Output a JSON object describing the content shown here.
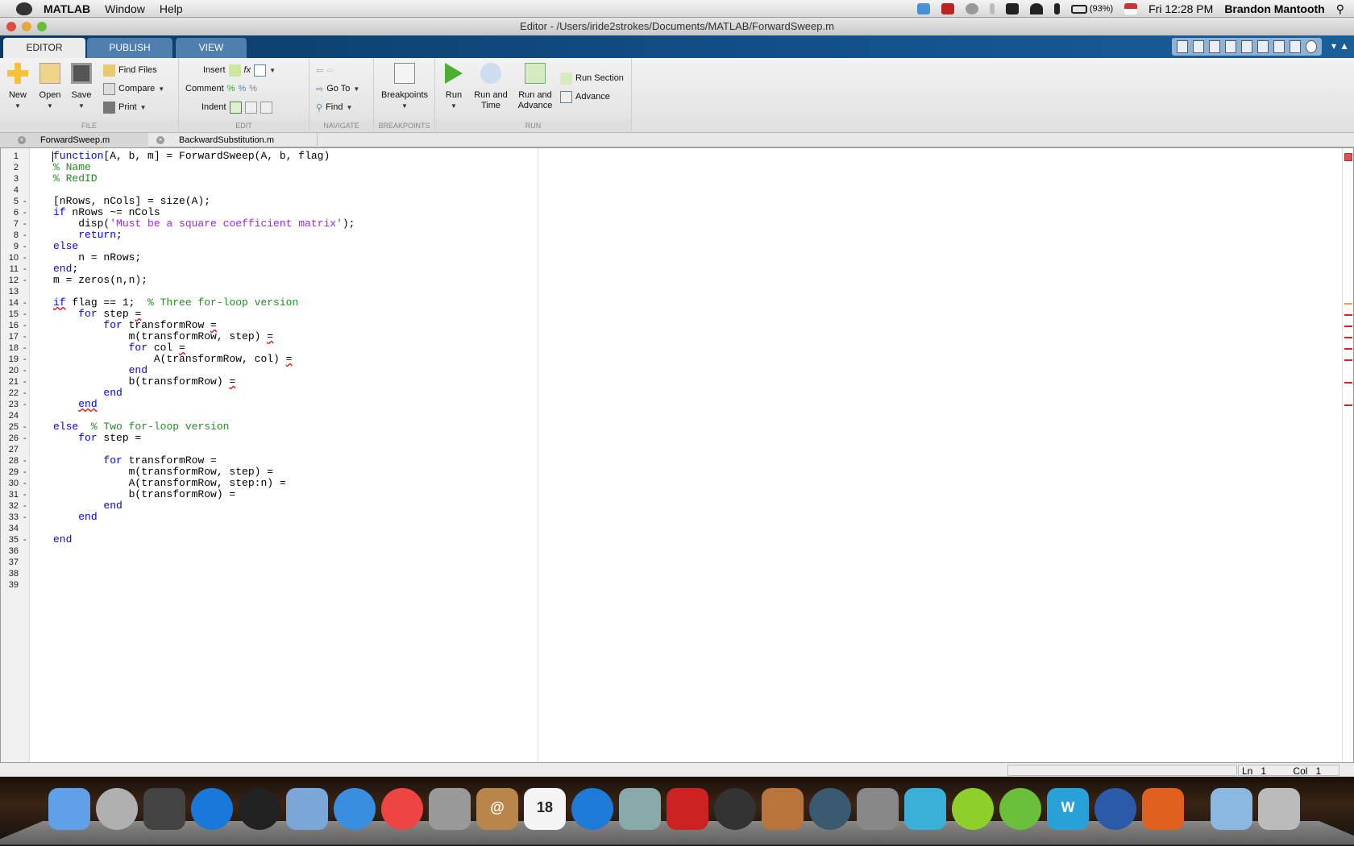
{
  "menubar": {
    "app": "MATLAB",
    "items": [
      "Window",
      "Help"
    ],
    "battery": "(93%)",
    "clock": "Fri 12:28 PM",
    "user": "Brandon Mantooth"
  },
  "window": {
    "title": "Editor - /Users/iride2strokes/Documents/MATLAB/ForwardSweep.m"
  },
  "ribbon": {
    "tabs": [
      "EDITOR",
      "PUBLISH",
      "VIEW"
    ],
    "file": {
      "label": "FILE",
      "new": "New",
      "open": "Open",
      "save": "Save",
      "find_files": "Find Files",
      "compare": "Compare",
      "print": "Print"
    },
    "edit": {
      "label": "EDIT",
      "insert": "Insert",
      "comment": "Comment",
      "indent": "Indent",
      "fx": "fx"
    },
    "navigate": {
      "label": "NAVIGATE",
      "goto": "Go To",
      "find": "Find"
    },
    "breakpoints": {
      "label": "BREAKPOINTS",
      "button": "Breakpoints"
    },
    "run": {
      "label": "RUN",
      "run": "Run",
      "run_and_time": "Run and Time",
      "run_and_advance": "Run and Advance",
      "run_section": "Run Section",
      "advance": "Advance"
    }
  },
  "file_tabs": [
    {
      "name": "ForwardSweep.m",
      "active": true
    },
    {
      "name": "BackwardSubstitution.m",
      "active": false
    }
  ],
  "editor": {
    "lines": [
      {
        "n": "1",
        "d": "",
        "segs": [
          [
            "kw",
            "function"
          ],
          [
            "",
            "[A, b, m] = ForwardSweep(A, b, flag)"
          ]
        ]
      },
      {
        "n": "2",
        "d": "",
        "segs": [
          [
            "cm",
            "% Name"
          ]
        ]
      },
      {
        "n": "3",
        "d": "",
        "segs": [
          [
            "cm",
            "% RedID"
          ]
        ]
      },
      {
        "n": "4",
        "d": "",
        "segs": []
      },
      {
        "n": "5",
        "d": "-",
        "segs": [
          [
            "",
            "[nRows, nCols] = size(A);"
          ]
        ]
      },
      {
        "n": "6",
        "d": "-",
        "segs": [
          [
            "kw",
            "if"
          ],
          [
            "",
            " nRows ~= nCols"
          ]
        ]
      },
      {
        "n": "7",
        "d": "-",
        "segs": [
          [
            "",
            "    disp("
          ],
          [
            "str",
            "'Must be a square coefficient matrix'"
          ],
          [
            "",
            ");"
          ]
        ]
      },
      {
        "n": "8",
        "d": "-",
        "segs": [
          [
            "",
            "    "
          ],
          [
            "kw",
            "return"
          ],
          [
            "",
            ";"
          ]
        ]
      },
      {
        "n": "9",
        "d": "-",
        "segs": [
          [
            "kw",
            "else"
          ]
        ]
      },
      {
        "n": "10",
        "d": "-",
        "segs": [
          [
            "",
            "    n = nRows;"
          ]
        ]
      },
      {
        "n": "11",
        "d": "-",
        "segs": [
          [
            "kw",
            "end"
          ],
          [
            "",
            ";"
          ]
        ]
      },
      {
        "n": "12",
        "d": "-",
        "segs": [
          [
            "",
            "m = zeros(n,n);"
          ]
        ]
      },
      {
        "n": "13",
        "d": "",
        "segs": []
      },
      {
        "n": "14",
        "d": "-",
        "segs": [
          [
            "kw warn",
            "if"
          ],
          [
            "",
            " flag == 1;  "
          ],
          [
            "cm",
            "% Three for-loop version"
          ]
        ]
      },
      {
        "n": "15",
        "d": "-",
        "segs": [
          [
            "",
            "    "
          ],
          [
            "kw",
            "for"
          ],
          [
            "",
            " step "
          ],
          [
            "warn",
            "="
          ]
        ]
      },
      {
        "n": "16",
        "d": "-",
        "segs": [
          [
            "",
            "        "
          ],
          [
            "kw",
            "for"
          ],
          [
            "",
            " transformRow "
          ],
          [
            "warn",
            "="
          ]
        ]
      },
      {
        "n": "17",
        "d": "-",
        "segs": [
          [
            "",
            "            m(transformRow, step) "
          ],
          [
            "warn",
            "="
          ]
        ]
      },
      {
        "n": "18",
        "d": "-",
        "segs": [
          [
            "",
            "            "
          ],
          [
            "kw",
            "for"
          ],
          [
            "",
            " col "
          ],
          [
            "warn",
            "="
          ]
        ]
      },
      {
        "n": "19",
        "d": "-",
        "segs": [
          [
            "",
            "                A(transformRow, col) "
          ],
          [
            "warn",
            "="
          ]
        ]
      },
      {
        "n": "20",
        "d": "-",
        "segs": [
          [
            "",
            "            "
          ],
          [
            "kw",
            "end"
          ]
        ]
      },
      {
        "n": "21",
        "d": "-",
        "segs": [
          [
            "",
            "            b(transformRow) "
          ],
          [
            "warn",
            "="
          ]
        ]
      },
      {
        "n": "22",
        "d": "-",
        "segs": [
          [
            "",
            "        "
          ],
          [
            "kw",
            "end"
          ]
        ]
      },
      {
        "n": "23",
        "d": "-",
        "segs": [
          [
            "",
            "    "
          ],
          [
            "kw warn",
            "end"
          ]
        ]
      },
      {
        "n": "24",
        "d": "",
        "segs": []
      },
      {
        "n": "25",
        "d": "-",
        "segs": [
          [
            "kw",
            "else"
          ],
          [
            "",
            "  "
          ],
          [
            "cm",
            "% Two for-loop version"
          ]
        ]
      },
      {
        "n": "26",
        "d": "-",
        "segs": [
          [
            "",
            "    "
          ],
          [
            "kw",
            "for"
          ],
          [
            "",
            " step ="
          ]
        ]
      },
      {
        "n": "27",
        "d": "",
        "segs": []
      },
      {
        "n": "28",
        "d": "-",
        "segs": [
          [
            "",
            "        "
          ],
          [
            "kw",
            "for"
          ],
          [
            "",
            " transformRow ="
          ]
        ]
      },
      {
        "n": "29",
        "d": "-",
        "segs": [
          [
            "",
            "            m(transformRow, step) ="
          ]
        ]
      },
      {
        "n": "30",
        "d": "-",
        "segs": [
          [
            "",
            "            A(transformRow, step:n) ="
          ]
        ]
      },
      {
        "n": "31",
        "d": "-",
        "segs": [
          [
            "",
            "            b(transformRow) ="
          ]
        ]
      },
      {
        "n": "32",
        "d": "-",
        "segs": [
          [
            "",
            "        "
          ],
          [
            "kw",
            "end"
          ]
        ]
      },
      {
        "n": "33",
        "d": "-",
        "segs": [
          [
            "",
            "    "
          ],
          [
            "kw",
            "end"
          ]
        ]
      },
      {
        "n": "34",
        "d": "",
        "segs": []
      },
      {
        "n": "35",
        "d": "-",
        "segs": [
          [
            "kw",
            "end"
          ]
        ]
      },
      {
        "n": "36",
        "d": "",
        "segs": []
      },
      {
        "n": "37",
        "d": "",
        "segs": []
      },
      {
        "n": "38",
        "d": "",
        "segs": []
      },
      {
        "n": "39",
        "d": "",
        "segs": []
      }
    ],
    "markers": [
      {
        "line": 14,
        "color": "#f0a030"
      },
      {
        "line": 15,
        "color": "#e02020"
      },
      {
        "line": 16,
        "color": "#e02020"
      },
      {
        "line": 17,
        "color": "#e02020"
      },
      {
        "line": 18,
        "color": "#e02020"
      },
      {
        "line": 19,
        "color": "#e02020"
      },
      {
        "line": 21,
        "color": "#e02020"
      },
      {
        "line": 23,
        "color": "#e02020"
      }
    ]
  },
  "status": {
    "ln_label": "Ln",
    "ln": "1",
    "col_label": "Col",
    "col": "1"
  },
  "dock": {
    "apps": [
      {
        "name": "Finder",
        "color": "#5fa0e8",
        "round": false
      },
      {
        "name": "Launchpad",
        "color": "#b0b0b0",
        "round": true
      },
      {
        "name": "Mission Control",
        "color": "#444",
        "round": false
      },
      {
        "name": "App Store",
        "color": "#1a78d8",
        "round": true
      },
      {
        "name": "Dashboard",
        "color": "#222",
        "round": true
      },
      {
        "name": "Mail",
        "color": "#7aa6d8",
        "round": false
      },
      {
        "name": "Safari",
        "color": "#3a8ee0",
        "round": true
      },
      {
        "name": "Chrome",
        "color": "#e44",
        "round": true
      },
      {
        "name": "FaceTime",
        "color": "#999",
        "round": false
      },
      {
        "name": "Contacts",
        "color": "#b8864a",
        "round": false,
        "text": "@"
      },
      {
        "name": "Calendar",
        "color": "#f4f4f4",
        "round": false,
        "text": "18"
      },
      {
        "name": "iTunes",
        "color": "#1d7ad6",
        "round": true
      },
      {
        "name": "iPhoto",
        "color": "#8aa"
      },
      {
        "name": "Photo Booth",
        "color": "#c22",
        "round": false
      },
      {
        "name": "iMovie",
        "color": "#333",
        "round": true
      },
      {
        "name": "GarageBand",
        "color": "#b8743a",
        "round": false
      },
      {
        "name": "Time Machine",
        "color": "#3a5a70",
        "round": true
      },
      {
        "name": "System Preferences",
        "color": "#888",
        "round": false
      },
      {
        "name": "Agent",
        "color": "#3ab0d8",
        "round": false
      },
      {
        "name": "Spotify",
        "color": "#8fcf2a",
        "round": true
      },
      {
        "name": "uTorrent",
        "color": "#6cbf3a",
        "round": true
      },
      {
        "name": "Word",
        "color": "#2aa0d8",
        "round": false,
        "text": "W"
      },
      {
        "name": "QuickTime",
        "color": "#2a5aa8",
        "round": true
      },
      {
        "name": "MATLAB",
        "color": "#e06020",
        "round": false
      },
      {
        "name": "Documents",
        "color": "#8ab8e0",
        "round": false
      },
      {
        "name": "Trash",
        "color": "#bbb",
        "round": false
      }
    ]
  }
}
